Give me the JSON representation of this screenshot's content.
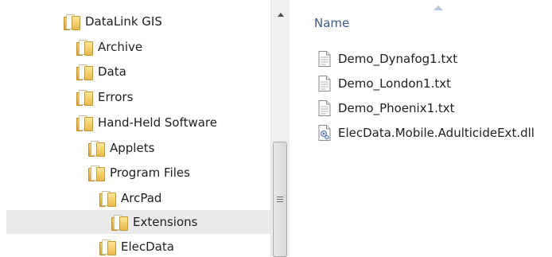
{
  "navigation": {
    "items": [
      {
        "label": "DataLink GIS",
        "depth": 0,
        "selected": false
      },
      {
        "label": "Archive",
        "depth": 1,
        "selected": false
      },
      {
        "label": "Data",
        "depth": 1,
        "selected": false
      },
      {
        "label": "Errors",
        "depth": 1,
        "selected": false
      },
      {
        "label": "Hand-Held Software",
        "depth": 1,
        "selected": false
      },
      {
        "label": "Applets",
        "depth": 2,
        "selected": false
      },
      {
        "label": "Program Files",
        "depth": 2,
        "selected": false
      },
      {
        "label": "ArcPad",
        "depth": 3,
        "selected": false
      },
      {
        "label": "Extensions",
        "depth": 4,
        "selected": true
      },
      {
        "label": "ElecData",
        "depth": 3,
        "selected": false
      }
    ]
  },
  "file_list": {
    "column_header": "Name",
    "files": [
      {
        "name": "Demo_Dynafog1.txt",
        "icon": "text-file-icon"
      },
      {
        "name": "Demo_London1.txt",
        "icon": "text-file-icon"
      },
      {
        "name": "Demo_Phoenix1.txt",
        "icon": "text-file-icon"
      },
      {
        "name": "ElecData.Mobile.AdulticideExt.dll",
        "icon": "dll-file-icon"
      }
    ]
  },
  "colors": {
    "header_text": "#3b5a84",
    "selected_row": "#eaeaea",
    "folder": "#eab74b"
  }
}
